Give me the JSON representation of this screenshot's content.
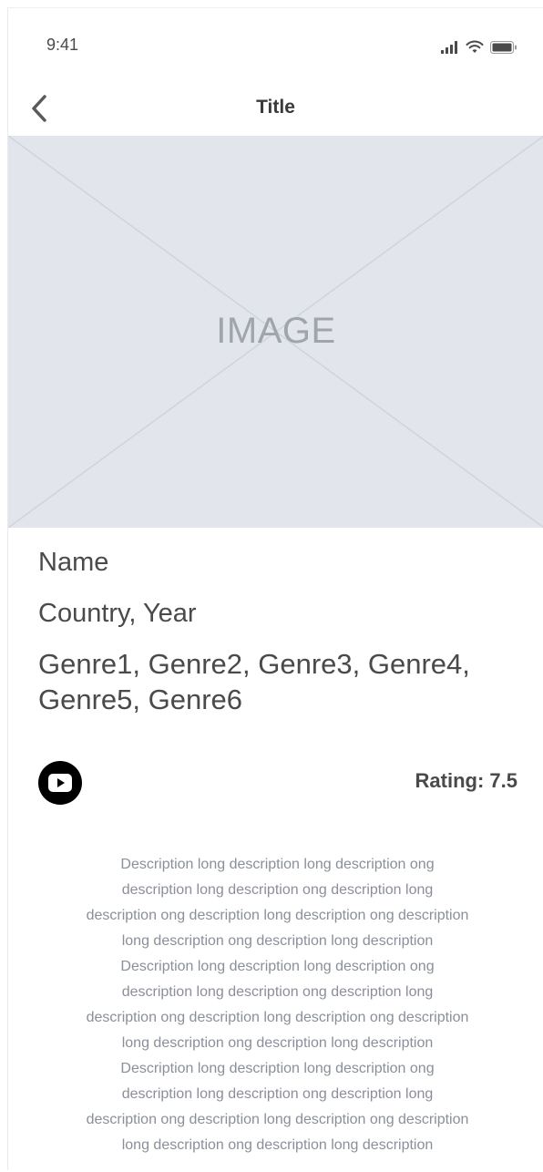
{
  "status_bar": {
    "time": "9:41",
    "icons": [
      "cellular-signal-icon",
      "wifi-icon",
      "battery-icon"
    ]
  },
  "nav": {
    "back_icon": "chevron-left-icon",
    "title": "Title"
  },
  "image": {
    "label": "IMAGE"
  },
  "details": {
    "name": "Name",
    "country_year": "Country, Year",
    "genres_line1": "Genre1, Genre2, Genre3, Genre4,",
    "genres_line2": "Genre5, Genre6"
  },
  "actions": {
    "play_icon": "youtube-play-icon",
    "rating": "Rating: 7.5"
  },
  "description": {
    "lines": [
      "Description long description long description ong",
      "description long description ong description long",
      "description ong description long description ong description",
      "long description ong description long description",
      "Description long description long description ong",
      "description long description ong description long",
      "description ong description long description ong description",
      "long description ong description long description",
      "Description long description long description ong",
      "description long description ong description long",
      "description ong description long description ong description",
      "long description ong description long description"
    ]
  },
  "colors": {
    "placeholder_bg": "#e2e5ec",
    "text_primary": "#4a4a4a",
    "text_secondary": "#8a8f99"
  }
}
